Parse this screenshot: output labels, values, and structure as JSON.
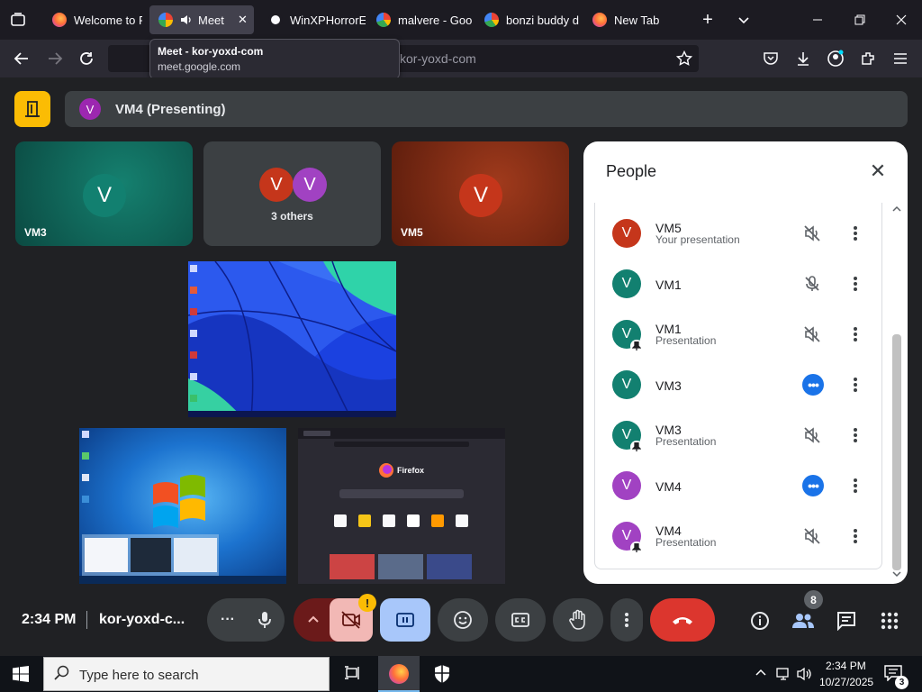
{
  "browser": {
    "tabs": [
      {
        "label": "Welcome to Fi",
        "favicon": "firefox-icon"
      },
      {
        "label": "Meet",
        "favicon": "meet-icon",
        "audio": true,
        "active": true
      },
      {
        "label": "WinXPHorrorE",
        "favicon": "github-icon"
      },
      {
        "label": "malvere - Goo",
        "favicon": "google-icon"
      },
      {
        "label": "bonzi buddy d",
        "favicon": "google-icon"
      },
      {
        "label": "New Tab",
        "favicon": "firefox-icon"
      }
    ],
    "url_text": "kor-yoxd-com",
    "tooltip": {
      "title": "Meet - kor-yoxd-com",
      "domain": "meet.google.com"
    }
  },
  "meet": {
    "presenting_banner": {
      "avatar_letter": "V",
      "label": "VM4 (Presenting)"
    },
    "tiles": [
      {
        "name": "VM3",
        "avatar_letter": "V",
        "color": "#0f6b5e"
      },
      {
        "name": "3 others",
        "avatar_letters": [
          "V",
          "V"
        ]
      },
      {
        "name": "VM5",
        "avatar_letter": "V",
        "color": "#8a2c12"
      }
    ],
    "people_panel": {
      "title": "People",
      "rows": [
        {
          "name": "VM5",
          "sub": "Your presentation",
          "avatar_letter": "V",
          "color": "#c5361b",
          "state": "muted",
          "pinned": false
        },
        {
          "name": "VM1",
          "sub": "",
          "avatar_letter": "V",
          "color": "#128070",
          "state": "mic-off",
          "pinned": false
        },
        {
          "name": "VM1",
          "sub": "Presentation",
          "avatar_letter": "V",
          "color": "#128070",
          "state": "muted",
          "pinned": true
        },
        {
          "name": "VM3",
          "sub": "",
          "avatar_letter": "V",
          "color": "#128070",
          "state": "speaking",
          "pinned": false
        },
        {
          "name": "VM3",
          "sub": "Presentation",
          "avatar_letter": "V",
          "color": "#128070",
          "state": "muted",
          "pinned": true
        },
        {
          "name": "VM4",
          "sub": "",
          "avatar_letter": "V",
          "color": "#a142c2",
          "state": "speaking",
          "pinned": false
        },
        {
          "name": "VM4",
          "sub": "Presentation",
          "avatar_letter": "V",
          "color": "#a142c2",
          "state": "muted",
          "pinned": true
        }
      ]
    },
    "controls": {
      "time": "2:34 PM",
      "meeting_code": "kor-yoxd-c...",
      "people_count": "8",
      "camera_warning": "!"
    },
    "screen_shares": {
      "firefox_label": "Firefox"
    }
  },
  "taskbar": {
    "search_placeholder": "Type here to search",
    "clock_time": "2:34 PM",
    "clock_date": "10/27/2025",
    "notification_count": "3"
  }
}
